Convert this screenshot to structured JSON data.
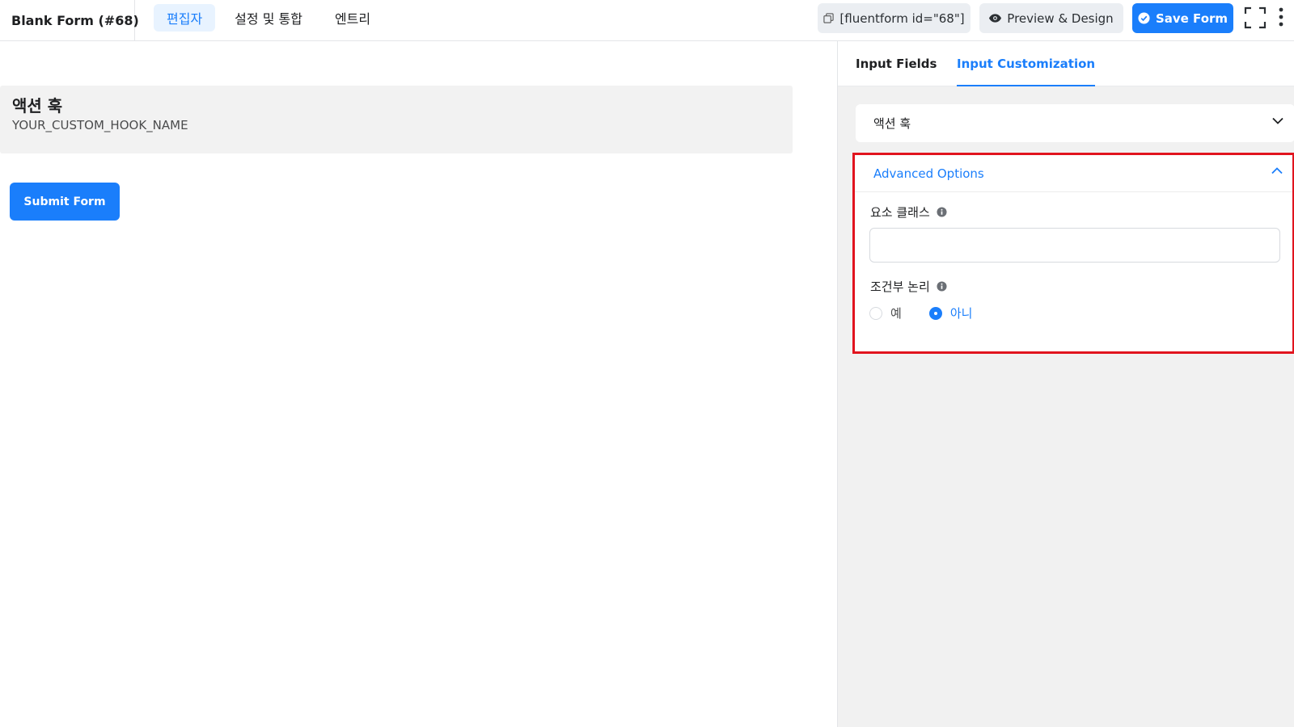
{
  "header": {
    "form_title": "Blank Form (#68)",
    "tabs": [
      {
        "label": "편집자",
        "active": true
      },
      {
        "label": "설정 및 통합",
        "active": false
      },
      {
        "label": "엔트리",
        "active": false
      }
    ],
    "shortcode_label": "[fluentform id=\"68\"]",
    "preview_label": "Preview & Design",
    "save_label": "Save Form"
  },
  "canvas": {
    "field_title": "액션 훅",
    "field_hook": "YOUR_CUSTOM_HOOK_NAME",
    "submit_label": "Submit Form"
  },
  "sidebar": {
    "tabs": [
      {
        "label": "Input Fields",
        "active": false
      },
      {
        "label": "Input Customization",
        "active": true
      }
    ],
    "collapsed_section": "액션 훅",
    "advanced": {
      "title": "Advanced Options",
      "element_class_label": "요소 클래스",
      "element_class_value": "",
      "conditional_label": "조건부 논리",
      "options": [
        {
          "label": "예",
          "checked": false
        },
        {
          "label": "아니",
          "checked": true
        }
      ]
    }
  },
  "colors": {
    "accent": "#1a7efb",
    "highlight_border": "#e1141e",
    "sidebar_bg": "#f1f1f1"
  },
  "icons": [
    "pencil-icon",
    "copy-icon",
    "eye-icon",
    "check-circle-icon",
    "fullscreen-icon",
    "more-vertical-icon",
    "chevron-down-icon",
    "chevron-up-icon",
    "info-icon"
  ]
}
